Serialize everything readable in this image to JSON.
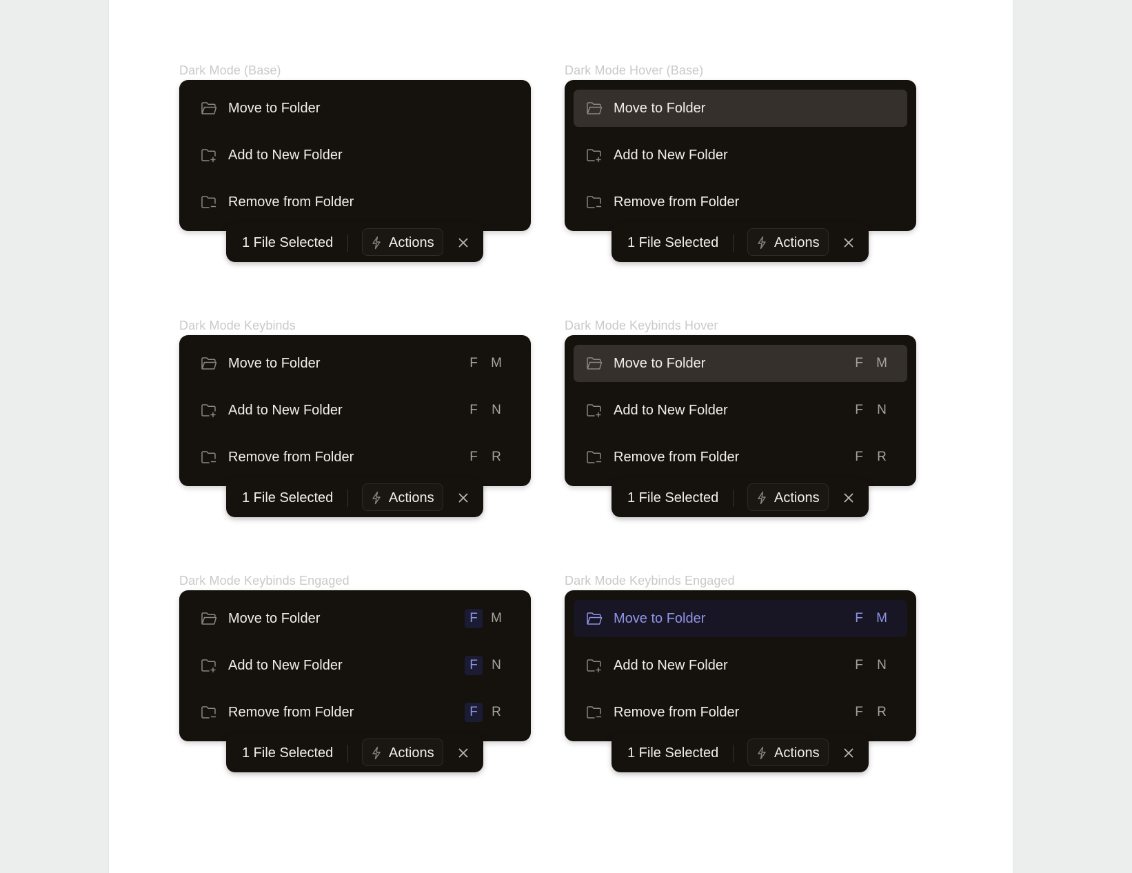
{
  "variants": [
    {
      "label": "Dark Mode (Base)",
      "items": [
        {
          "label": "Move to Folder",
          "icon": "folder-open-icon",
          "state": "normal"
        },
        {
          "label": "Add to New Folder",
          "icon": "folder-plus-icon",
          "state": "normal"
        },
        {
          "label": "Remove from Folder",
          "icon": "folder-minus-icon",
          "state": "normal"
        }
      ]
    },
    {
      "label": "Dark Mode Hover (Base)",
      "items": [
        {
          "label": "Move to Folder",
          "icon": "folder-open-icon",
          "state": "hover"
        },
        {
          "label": "Add to New Folder",
          "icon": "folder-plus-icon",
          "state": "normal"
        },
        {
          "label": "Remove from Folder",
          "icon": "folder-minus-icon",
          "state": "normal"
        }
      ]
    },
    {
      "label": "Dark Mode Keybinds",
      "items": [
        {
          "label": "Move to Folder",
          "icon": "folder-open-icon",
          "state": "normal",
          "keys": [
            "F",
            "M"
          ]
        },
        {
          "label": "Add to New Folder",
          "icon": "folder-plus-icon",
          "state": "normal",
          "keys": [
            "F",
            "N"
          ]
        },
        {
          "label": "Remove from Folder",
          "icon": "folder-minus-icon",
          "state": "normal",
          "keys": [
            "F",
            "R"
          ]
        }
      ]
    },
    {
      "label": "Dark Mode Keybinds Hover",
      "items": [
        {
          "label": "Move to Folder",
          "icon": "folder-open-icon",
          "state": "hover",
          "keys": [
            "F",
            "M"
          ]
        },
        {
          "label": "Add to New Folder",
          "icon": "folder-plus-icon",
          "state": "normal",
          "keys": [
            "F",
            "N"
          ]
        },
        {
          "label": "Remove from Folder",
          "icon": "folder-minus-icon",
          "state": "normal",
          "keys": [
            "F",
            "R"
          ]
        }
      ]
    },
    {
      "label": "Dark Mode Keybinds Engaged",
      "items": [
        {
          "label": "Move to Folder",
          "icon": "folder-open-icon",
          "state": "normal",
          "keys": [
            "F",
            "M"
          ],
          "key_engaged": [
            true,
            false
          ]
        },
        {
          "label": "Add to New Folder",
          "icon": "folder-plus-icon",
          "state": "normal",
          "keys": [
            "F",
            "N"
          ],
          "key_engaged": [
            true,
            false
          ]
        },
        {
          "label": "Remove from Folder",
          "icon": "folder-minus-icon",
          "state": "normal",
          "keys": [
            "F",
            "R"
          ],
          "key_engaged": [
            true,
            false
          ]
        }
      ]
    },
    {
      "label": "Dark Mode Keybinds Engaged",
      "items": [
        {
          "label": "Move to Folder",
          "icon": "folder-open-icon",
          "state": "engaged",
          "keys": [
            "F",
            "M"
          ],
          "key_active": [
            true,
            true
          ]
        },
        {
          "label": "Add to New Folder",
          "icon": "folder-plus-icon",
          "state": "normal",
          "keys": [
            "F",
            "N"
          ]
        },
        {
          "label": "Remove from Folder",
          "icon": "folder-minus-icon",
          "state": "normal",
          "keys": [
            "F",
            "R"
          ]
        }
      ]
    }
  ],
  "selection_bar": {
    "count_label": "1 File Selected",
    "actions_label": "Actions",
    "actions_icon": "lightning-bolt-icon",
    "close_icon": "close-icon"
  },
  "colors": {
    "panel": "#15110c",
    "hover_row": "#35302b",
    "engaged_row": "#181524",
    "accent": "#8f95e6",
    "text": "#f2efea",
    "muted": "#a8a39c",
    "label": "#c9c9c9"
  }
}
